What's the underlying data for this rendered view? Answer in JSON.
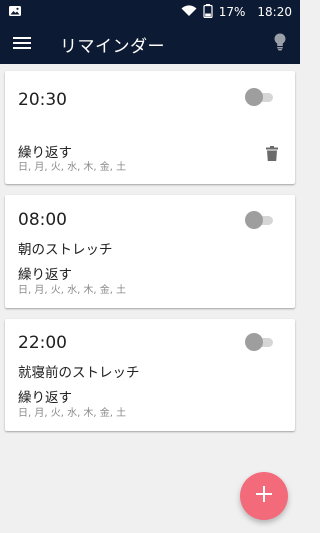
{
  "status_bar": {
    "battery": "17%",
    "time": "18:20",
    "icons": [
      "image-icon",
      "wifi-icon",
      "battery-icon"
    ]
  },
  "app_bar": {
    "title": "リマインダー",
    "icons": [
      "menu-icon",
      "lightbulb-icon"
    ]
  },
  "reminders": [
    {
      "time": "20:30",
      "label": "",
      "repeat": "繰り返す",
      "days": "日, 月, 火, 水, 木, 金, 土",
      "enabled": false,
      "show_delete": true
    },
    {
      "time": "08:00",
      "label": "朝のストレッチ",
      "repeat": "繰り返す",
      "days": "日, 月, 火, 水, 木, 金, 土",
      "enabled": false,
      "show_delete": false
    },
    {
      "time": "22:00",
      "label": "就寝前のストレッチ",
      "repeat": "繰り返す",
      "days": "日, 月, 火, 水, 木, 金, 土",
      "enabled": false,
      "show_delete": false
    }
  ],
  "fab": {
    "icon": "add-icon"
  },
  "colors": {
    "app_bar": "#0d1a33",
    "background": "#f0f0f0",
    "fab": "#f36a7a",
    "toggle_off_thumb": "#9e9e9e"
  }
}
